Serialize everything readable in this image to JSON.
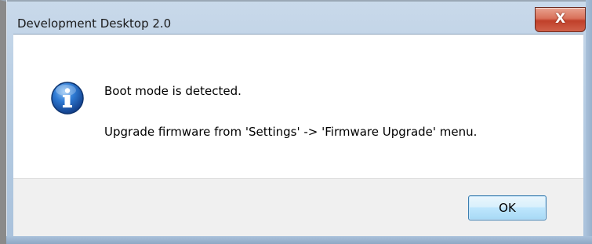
{
  "window": {
    "title": "Development Desktop 2.0",
    "close_label": "X"
  },
  "message": {
    "icon": "info-icon",
    "line1": "Boot mode is detected.",
    "line2": "Upgrade firmware from 'Settings' -> 'Firmware Upgrade' menu."
  },
  "buttons": {
    "ok_label": "OK"
  },
  "colors": {
    "title_bar": "#b7cde3",
    "close_button": "#c0402a",
    "content_background": "#ffffff",
    "footer_background": "#f0f0f0",
    "info_icon": "#1f5fb0"
  }
}
